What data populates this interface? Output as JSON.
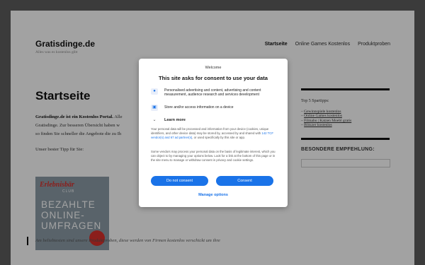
{
  "site": {
    "title": "Gratisdinge.de",
    "tagline": "Alles was es kostenlos gibt"
  },
  "nav": [
    {
      "label": "Startseite",
      "active": true
    },
    {
      "label": "Online Games Kostenlos",
      "active": false
    },
    {
      "label": "Produktproben",
      "active": false
    }
  ],
  "content": {
    "title": "Startseite",
    "intro_bold": "Gratisdinge.de ist ein Kostenlos Portal.",
    "intro_line1_rest": " Alle",
    "intro_line2": "Gratisdinge. Zur besseren Übersicht haben w",
    "intro_line3": "so finden Sie schneller die Angebote die zu Ih",
    "tip_label": "Unser bester Tipp für Sie:",
    "promo": {
      "brand": "Erlebnisbär",
      "club": "CLUB",
      "line1": "BEZAHLTE",
      "line2": "ONLINE-",
      "line3": "UMFRAGEN"
    },
    "quote": "Am beliebtesten sind unsere Produktproben, diese werden von Firmen kostenlos verschickt um ihre"
  },
  "sidebar": {
    "widget1": {
      "title": "Top 5 Spartipps:",
      "items": [
        "Gewinnspiele kostenlos",
        "Online Games kostenlos",
        "Filmabo | Katzen Moebl gratis",
        "Blitzzer kostenlos"
      ]
    },
    "widget2": {
      "title": "BESONDERE EMPFEHLUNG:"
    }
  },
  "consent": {
    "welcome": "Welcome",
    "title": "This site asks for consent to use your data",
    "items": [
      {
        "icon": "person-icon",
        "text": "Personalised advertising and content, advertising and content measurement, audience research and services development"
      },
      {
        "icon": "device-icon",
        "text": "Store and/or access information on a device"
      }
    ],
    "learn_more": "Learn more",
    "body1_a": "Your personal data will be processed and information from your device (cookies, unique identifiers, and other device data) may be stored by, accessed by and shared with ",
    "body1_link": "142 TCF vendor(s) and 67 ad partner(s)",
    "body1_b": ", or used specifically by this site or app.",
    "body2": "Some vendors may process your personal data on the basis of legitimate interest, which you can object to by managing your options below. Look for a link at the bottom of this page or in the site menu to manage or withdraw consent in privacy and cookie settings.",
    "do_not_consent": "Do not consent",
    "consent": "Consent",
    "manage": "Manage options"
  }
}
